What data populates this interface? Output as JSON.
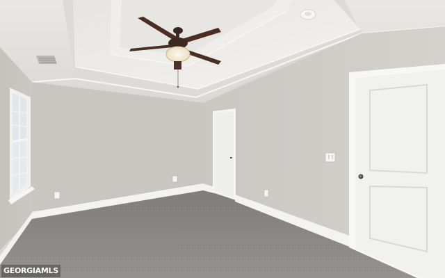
{
  "watermark": {
    "text": "GEORGIAMLS"
  },
  "colors": {
    "wall_left": "#c9c7c2",
    "wall_back": "#cbc9c4",
    "wall_right": "#cecbc6",
    "ceiling": "#e3e2de",
    "tray_ceiling": "#ecebe8",
    "trim": "#f4f4f2",
    "door": "#f1f1ef",
    "carpet": "#8d8b8a",
    "fan_blade": "#4a2e22",
    "fan_light": "#f3e7cf"
  }
}
